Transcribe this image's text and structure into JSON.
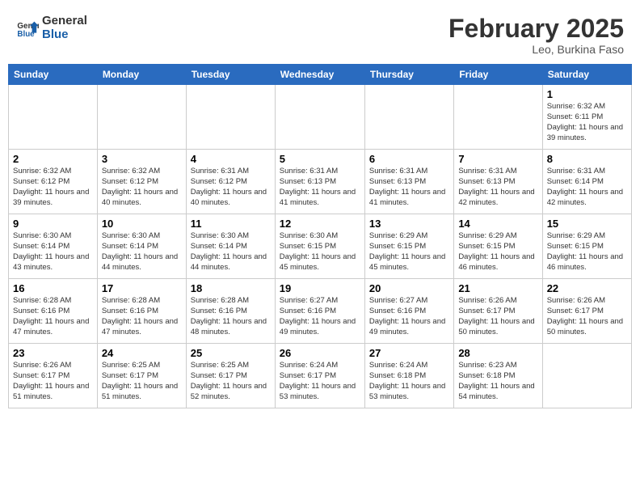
{
  "header": {
    "logo_general": "General",
    "logo_blue": "Blue",
    "month": "February 2025",
    "location": "Leo, Burkina Faso"
  },
  "weekdays": [
    "Sunday",
    "Monday",
    "Tuesday",
    "Wednesday",
    "Thursday",
    "Friday",
    "Saturday"
  ],
  "weeks": [
    [
      {
        "day": "",
        "info": ""
      },
      {
        "day": "",
        "info": ""
      },
      {
        "day": "",
        "info": ""
      },
      {
        "day": "",
        "info": ""
      },
      {
        "day": "",
        "info": ""
      },
      {
        "day": "",
        "info": ""
      },
      {
        "day": "1",
        "info": "Sunrise: 6:32 AM\nSunset: 6:11 PM\nDaylight: 11 hours and 39 minutes."
      }
    ],
    [
      {
        "day": "2",
        "info": "Sunrise: 6:32 AM\nSunset: 6:12 PM\nDaylight: 11 hours and 39 minutes."
      },
      {
        "day": "3",
        "info": "Sunrise: 6:32 AM\nSunset: 6:12 PM\nDaylight: 11 hours and 40 minutes."
      },
      {
        "day": "4",
        "info": "Sunrise: 6:31 AM\nSunset: 6:12 PM\nDaylight: 11 hours and 40 minutes."
      },
      {
        "day": "5",
        "info": "Sunrise: 6:31 AM\nSunset: 6:13 PM\nDaylight: 11 hours and 41 minutes."
      },
      {
        "day": "6",
        "info": "Sunrise: 6:31 AM\nSunset: 6:13 PM\nDaylight: 11 hours and 41 minutes."
      },
      {
        "day": "7",
        "info": "Sunrise: 6:31 AM\nSunset: 6:13 PM\nDaylight: 11 hours and 42 minutes."
      },
      {
        "day": "8",
        "info": "Sunrise: 6:31 AM\nSunset: 6:14 PM\nDaylight: 11 hours and 42 minutes."
      }
    ],
    [
      {
        "day": "9",
        "info": "Sunrise: 6:30 AM\nSunset: 6:14 PM\nDaylight: 11 hours and 43 minutes."
      },
      {
        "day": "10",
        "info": "Sunrise: 6:30 AM\nSunset: 6:14 PM\nDaylight: 11 hours and 44 minutes."
      },
      {
        "day": "11",
        "info": "Sunrise: 6:30 AM\nSunset: 6:14 PM\nDaylight: 11 hours and 44 minutes."
      },
      {
        "day": "12",
        "info": "Sunrise: 6:30 AM\nSunset: 6:15 PM\nDaylight: 11 hours and 45 minutes."
      },
      {
        "day": "13",
        "info": "Sunrise: 6:29 AM\nSunset: 6:15 PM\nDaylight: 11 hours and 45 minutes."
      },
      {
        "day": "14",
        "info": "Sunrise: 6:29 AM\nSunset: 6:15 PM\nDaylight: 11 hours and 46 minutes."
      },
      {
        "day": "15",
        "info": "Sunrise: 6:29 AM\nSunset: 6:15 PM\nDaylight: 11 hours and 46 minutes."
      }
    ],
    [
      {
        "day": "16",
        "info": "Sunrise: 6:28 AM\nSunset: 6:16 PM\nDaylight: 11 hours and 47 minutes."
      },
      {
        "day": "17",
        "info": "Sunrise: 6:28 AM\nSunset: 6:16 PM\nDaylight: 11 hours and 47 minutes."
      },
      {
        "day": "18",
        "info": "Sunrise: 6:28 AM\nSunset: 6:16 PM\nDaylight: 11 hours and 48 minutes."
      },
      {
        "day": "19",
        "info": "Sunrise: 6:27 AM\nSunset: 6:16 PM\nDaylight: 11 hours and 49 minutes."
      },
      {
        "day": "20",
        "info": "Sunrise: 6:27 AM\nSunset: 6:16 PM\nDaylight: 11 hours and 49 minutes."
      },
      {
        "day": "21",
        "info": "Sunrise: 6:26 AM\nSunset: 6:17 PM\nDaylight: 11 hours and 50 minutes."
      },
      {
        "day": "22",
        "info": "Sunrise: 6:26 AM\nSunset: 6:17 PM\nDaylight: 11 hours and 50 minutes."
      }
    ],
    [
      {
        "day": "23",
        "info": "Sunrise: 6:26 AM\nSunset: 6:17 PM\nDaylight: 11 hours and 51 minutes."
      },
      {
        "day": "24",
        "info": "Sunrise: 6:25 AM\nSunset: 6:17 PM\nDaylight: 11 hours and 51 minutes."
      },
      {
        "day": "25",
        "info": "Sunrise: 6:25 AM\nSunset: 6:17 PM\nDaylight: 11 hours and 52 minutes."
      },
      {
        "day": "26",
        "info": "Sunrise: 6:24 AM\nSunset: 6:17 PM\nDaylight: 11 hours and 53 minutes."
      },
      {
        "day": "27",
        "info": "Sunrise: 6:24 AM\nSunset: 6:18 PM\nDaylight: 11 hours and 53 minutes."
      },
      {
        "day": "28",
        "info": "Sunrise: 6:23 AM\nSunset: 6:18 PM\nDaylight: 11 hours and 54 minutes."
      },
      {
        "day": "",
        "info": ""
      }
    ]
  ]
}
